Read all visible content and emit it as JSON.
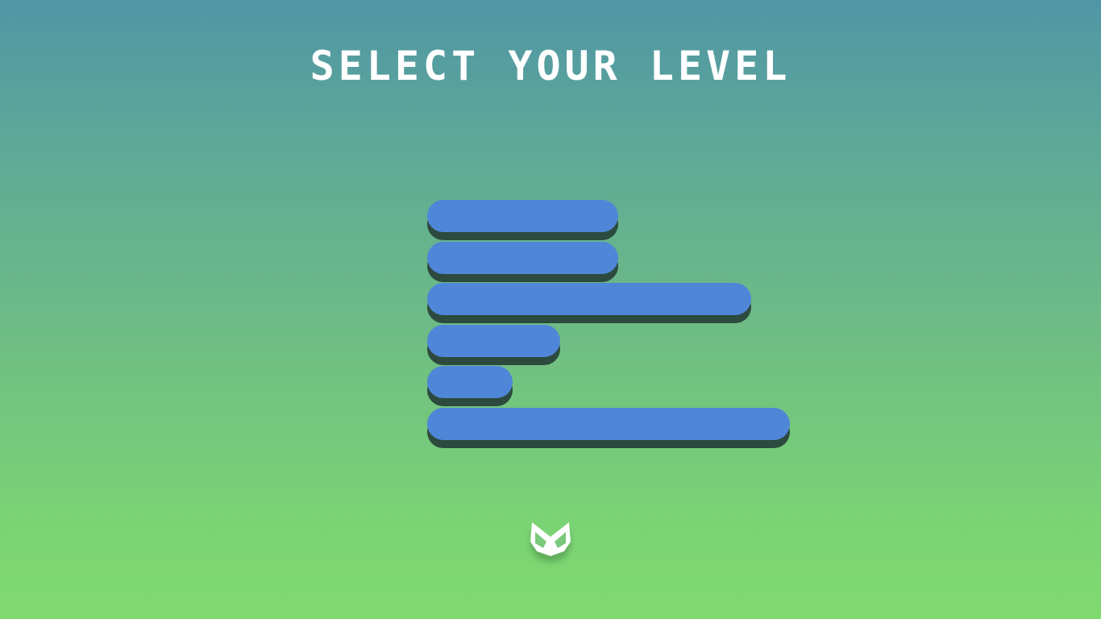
{
  "title": "SELECT YOUR LEVEL",
  "colors": {
    "button": "#4f86d8",
    "button_shadow": "#2c4a3e",
    "title": "#ffffff",
    "logo": "#ffffff"
  },
  "levels": [
    {
      "label": "",
      "fill": 0.49
    },
    {
      "label": "",
      "fill": 0.49
    },
    {
      "label": "",
      "fill": 0.83
    },
    {
      "label": "",
      "fill": 0.34
    },
    {
      "label": "",
      "fill": 0.22
    },
    {
      "label": "",
      "fill": 0.93
    }
  ],
  "logo": {
    "icon": "fox-logo-icon"
  }
}
